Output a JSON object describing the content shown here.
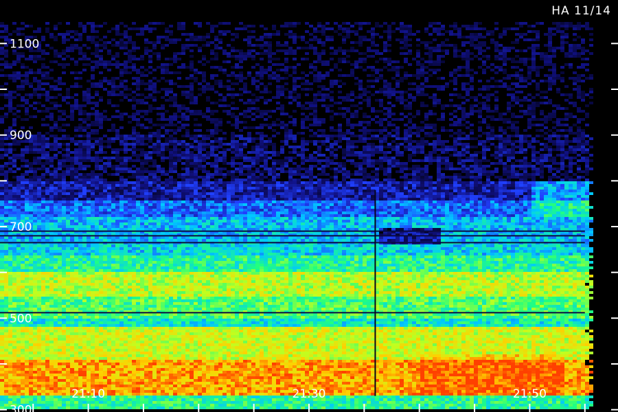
{
  "station_label": "HA 11/14",
  "chart_data": {
    "type": "heatmap",
    "title": "",
    "xlabel": "",
    "ylabel": "",
    "x_range": [
      "21:02",
      "21:58"
    ],
    "y_range": [
      295,
      1195
    ],
    "x_ticks": [
      "21:10",
      "21:30",
      "21:50"
    ],
    "y_ticks": [
      300,
      500,
      700,
      900,
      1100
    ],
    "x_minor_ticks": [
      "21:05",
      "21:10",
      "21:15",
      "21:20",
      "21:25",
      "21:30",
      "21:35",
      "21:40",
      "21:45",
      "21:50",
      "21:55"
    ],
    "y_minor_ticks": [
      300,
      400,
      500,
      600,
      700,
      800,
      900,
      1000,
      1100
    ],
    "colormap": [
      "#000000",
      "#101080",
      "#2040ff",
      "#00c8ff",
      "#20ff80",
      "#c0ff20",
      "#ffd000",
      "#ff4000"
    ],
    "series_bands": [
      {
        "y_from": 300,
        "y_to": 330,
        "level": 0.55
      },
      {
        "y_from": 330,
        "y_to": 410,
        "level": 0.9
      },
      {
        "y_from": 410,
        "y_to": 480,
        "level": 0.75
      },
      {
        "y_from": 480,
        "y_to": 500,
        "level": 0.5
      },
      {
        "y_from": 500,
        "y_to": 545,
        "level": 0.6
      },
      {
        "y_from": 545,
        "y_to": 600,
        "level": 0.72
      },
      {
        "y_from": 600,
        "y_to": 640,
        "level": 0.55
      },
      {
        "y_from": 640,
        "y_to": 670,
        "level": 0.45
      },
      {
        "y_from": 670,
        "y_to": 720,
        "level": 0.42
      },
      {
        "y_from": 720,
        "y_to": 760,
        "level": 0.32
      },
      {
        "y_from": 760,
        "y_to": 800,
        "level": 0.18
      },
      {
        "y_from": 800,
        "y_to": 900,
        "level": 0.1
      },
      {
        "y_from": 900,
        "y_to": 1150,
        "level": 0.05
      }
    ],
    "dark_lines": [
      512,
      665,
      680,
      690
    ],
    "data_gap_time": "21:36",
    "signal_cutoff_time": "21:55"
  }
}
